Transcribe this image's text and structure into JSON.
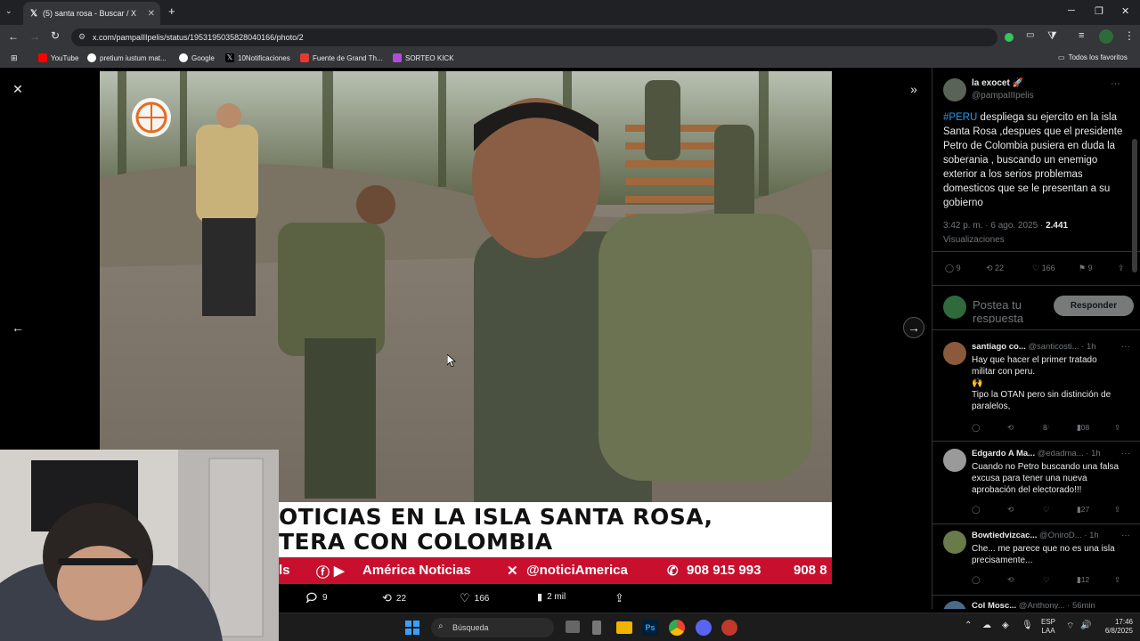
{
  "browser": {
    "tab_title": "(5) santa rosa - Buscar / X",
    "url": "x.com/pampaIIIpelis/status/1953195035828040166/photo/2",
    "new_tab": "+",
    "bookmarks": [
      {
        "label": "YouTube",
        "color": "#ff0000"
      },
      {
        "label": "pretium iustum mat...",
        "color": "#ffffff"
      },
      {
        "label": "Google",
        "color": "#ffffff"
      },
      {
        "label": "10Notificaciones",
        "color": "#000000"
      },
      {
        "label": "Fuente de Grand Th...",
        "color": "#e53935"
      },
      {
        "label": "SORTEO KICK",
        "color": "#b04cd9"
      }
    ],
    "all_favorites": "Todos los favoritos"
  },
  "media": {
    "banner_line1": "OTICIAS EN LA ISLA SANTA ROSA,",
    "banner_line2": "TERA CON COLOMBIA",
    "ticker": [
      "ls",
      "América Noticias",
      "@noticiAmerica",
      "908 915 993",
      "908 8"
    ],
    "actions": {
      "replies": "9",
      "reposts": "22",
      "likes": "166",
      "views": "2 mil"
    }
  },
  "post": {
    "display_name": "la exocet 🚀",
    "handle": "@pampaIIIpelis",
    "hashtag": "#PERU",
    "text": " despliega su ejercito en la isla Santa Rosa ,despues que el presidente Petro de Colombia pusiera en duda la soberania , buscando un enemigo exterior a los serios problemas domesticos que se le presentan a su gobierno",
    "time": "3:42 p. m. · 6 ago. 2025 · ",
    "views_count": "2.441",
    "views_label": "Visualizaciones",
    "stats": {
      "replies": "9",
      "reposts": "22",
      "likes": "166",
      "bookmarks": "9"
    },
    "reply_placeholder": "Postea tu respuesta",
    "reply_button": "Responder"
  },
  "replies": [
    {
      "name": "santiago co...",
      "handle": "@santicosti...",
      "time": "· 1h",
      "text": "Hay que hacer el primer tratado militar con peru.\n🙌\nTipo la OTAN pero sin distinción de paralelos,",
      "likes": "8",
      "views": "208",
      "avatar_color": "#8b5a3c"
    },
    {
      "name": "Edgardo A Ma...",
      "handle": "@edadma...",
      "time": "· 1h",
      "text": "Cuando no Petro buscando una falsa excusa para tener una nueva aprobación del electorado!!!",
      "likes": "",
      "views": "127",
      "avatar_color": "#9a9a9a"
    },
    {
      "name": "Bowtiedvizcac...",
      "handle": "@OniroD...",
      "time": "· 1h",
      "text": "Che... me parece que no es una isla precisamente...",
      "likes": "",
      "views": "212",
      "avatar_color": "#6a7a4a"
    },
    {
      "name": "Col Mosc...",
      "handle": "@Anthony...",
      "time": "· 56min",
      "text": "",
      "likes": "",
      "views": "",
      "avatar_color": "#4a6a8a"
    }
  ],
  "taskbar": {
    "search_placeholder": "Búsqueda",
    "lang1": "ESP",
    "lang2": "LAA",
    "time": "17:46",
    "date": "6/8/2025"
  }
}
